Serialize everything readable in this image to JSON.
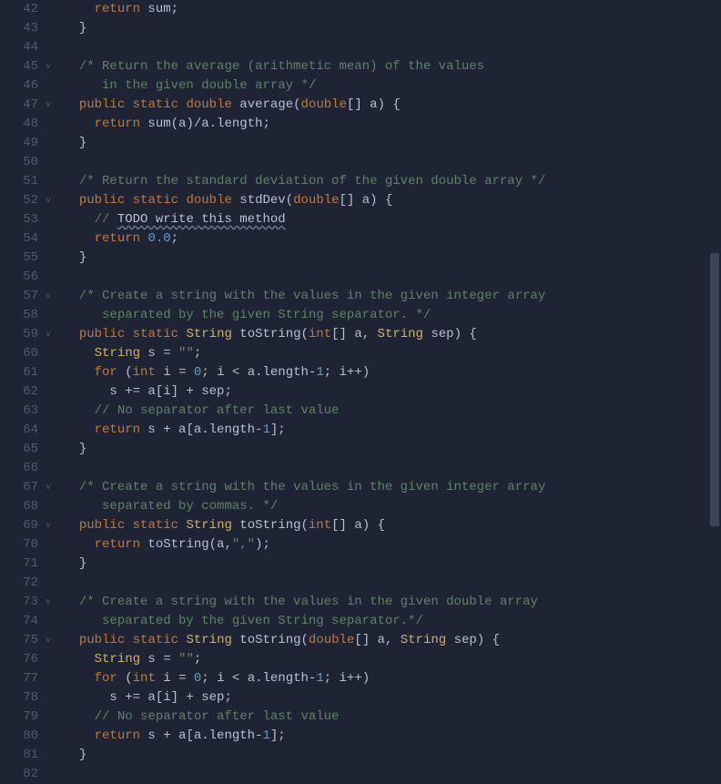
{
  "editor": {
    "startLine": 42,
    "lines": [
      {
        "n": 42,
        "fold": "",
        "tokens": [
          [
            "tk-guide",
            "    "
          ],
          [
            "tk-return",
            "return"
          ],
          [
            "tk-default",
            " sum"
          ],
          [
            "tk-op",
            ";"
          ]
        ]
      },
      {
        "n": 43,
        "fold": "",
        "tokens": [
          [
            "tk-guide",
            "  "
          ],
          [
            "tk-op",
            "}"
          ]
        ]
      },
      {
        "n": 44,
        "fold": "",
        "tokens": []
      },
      {
        "n": 45,
        "fold": "v",
        "tokens": [
          [
            "tk-guide",
            "  "
          ],
          [
            "tk-comment",
            "/* Return the average (arithmetic mean) of the values"
          ]
        ]
      },
      {
        "n": 46,
        "fold": "",
        "tokens": [
          [
            "tk-guide",
            "  "
          ],
          [
            "tk-comment",
            "   in the given double array */"
          ]
        ]
      },
      {
        "n": 47,
        "fold": "v",
        "tokens": [
          [
            "tk-guide",
            "  "
          ],
          [
            "tk-keyword",
            "public"
          ],
          [
            "tk-default",
            " "
          ],
          [
            "tk-keyword",
            "static"
          ],
          [
            "tk-default",
            " "
          ],
          [
            "tk-type",
            "double"
          ],
          [
            "tk-default",
            " average("
          ],
          [
            "tk-type",
            "double"
          ],
          [
            "tk-default",
            "[] a) {"
          ]
        ]
      },
      {
        "n": 48,
        "fold": "",
        "tokens": [
          [
            "tk-guide",
            "    "
          ],
          [
            "tk-return",
            "return"
          ],
          [
            "tk-default",
            " sum(a)/a.length"
          ],
          [
            "tk-op",
            ";"
          ]
        ]
      },
      {
        "n": 49,
        "fold": "",
        "tokens": [
          [
            "tk-guide",
            "  "
          ],
          [
            "tk-op",
            "}"
          ]
        ]
      },
      {
        "n": 50,
        "fold": "",
        "tokens": []
      },
      {
        "n": 51,
        "fold": "",
        "tokens": [
          [
            "tk-guide",
            "  "
          ],
          [
            "tk-comment",
            "/* Return the standard deviation of the given double array */"
          ]
        ]
      },
      {
        "n": 52,
        "fold": "v",
        "tokens": [
          [
            "tk-guide",
            "  "
          ],
          [
            "tk-keyword",
            "public"
          ],
          [
            "tk-default",
            " "
          ],
          [
            "tk-keyword",
            "static"
          ],
          [
            "tk-default",
            " "
          ],
          [
            "tk-type",
            "double"
          ],
          [
            "tk-default",
            " stdDev("
          ],
          [
            "tk-type",
            "double"
          ],
          [
            "tk-default",
            "[] a) {"
          ]
        ]
      },
      {
        "n": 53,
        "fold": "",
        "tokens": [
          [
            "tk-guide",
            "    "
          ],
          [
            "tk-linecomment",
            "// "
          ],
          [
            "tk-todo",
            "TODO write this method"
          ]
        ]
      },
      {
        "n": 54,
        "fold": "",
        "tokens": [
          [
            "tk-guide",
            "    "
          ],
          [
            "tk-return",
            "return"
          ],
          [
            "tk-default",
            " "
          ],
          [
            "tk-number",
            "0.0"
          ],
          [
            "tk-op",
            ";"
          ]
        ]
      },
      {
        "n": 55,
        "fold": "",
        "tokens": [
          [
            "tk-guide",
            "  "
          ],
          [
            "tk-op",
            "}"
          ]
        ]
      },
      {
        "n": 56,
        "fold": "",
        "tokens": []
      },
      {
        "n": 57,
        "fold": "v",
        "tokens": [
          [
            "tk-guide",
            "  "
          ],
          [
            "tk-comment",
            "/* Create a string with the values in the given integer array"
          ]
        ]
      },
      {
        "n": 58,
        "fold": "",
        "tokens": [
          [
            "tk-guide",
            "  "
          ],
          [
            "tk-comment",
            "   separated by the given String separator. */"
          ]
        ]
      },
      {
        "n": 59,
        "fold": "v",
        "tokens": [
          [
            "tk-guide",
            "  "
          ],
          [
            "tk-keyword",
            "public"
          ],
          [
            "tk-default",
            " "
          ],
          [
            "tk-keyword",
            "static"
          ],
          [
            "tk-default",
            " "
          ],
          [
            "tk-classType",
            "String"
          ],
          [
            "tk-default",
            " toString("
          ],
          [
            "tk-type",
            "int"
          ],
          [
            "tk-default",
            "[] a, "
          ],
          [
            "tk-classType",
            "String"
          ],
          [
            "tk-default",
            " sep) {"
          ]
        ]
      },
      {
        "n": 60,
        "fold": "",
        "tokens": [
          [
            "tk-guide",
            "    "
          ],
          [
            "tk-classType",
            "String"
          ],
          [
            "tk-default",
            " s = "
          ],
          [
            "tk-string",
            "\"\""
          ],
          [
            "tk-op",
            ";"
          ]
        ]
      },
      {
        "n": 61,
        "fold": "",
        "tokens": [
          [
            "tk-guide",
            "    "
          ],
          [
            "tk-keyword",
            "for"
          ],
          [
            "tk-default",
            " ("
          ],
          [
            "tk-type",
            "int"
          ],
          [
            "tk-default",
            " i = "
          ],
          [
            "tk-number",
            "0"
          ],
          [
            "tk-default",
            "; i < a.length-"
          ],
          [
            "tk-number",
            "1"
          ],
          [
            "tk-default",
            "; i++)"
          ]
        ]
      },
      {
        "n": 62,
        "fold": "",
        "tokens": [
          [
            "tk-guide",
            "      "
          ],
          [
            "tk-default",
            "s += a[i] + sep;"
          ]
        ]
      },
      {
        "n": 63,
        "fold": "",
        "tokens": [
          [
            "tk-guide",
            "    "
          ],
          [
            "tk-linecomment",
            "// No separator after last value"
          ]
        ]
      },
      {
        "n": 64,
        "fold": "",
        "tokens": [
          [
            "tk-guide",
            "    "
          ],
          [
            "tk-return",
            "return"
          ],
          [
            "tk-default",
            " s + a[a.length-"
          ],
          [
            "tk-number",
            "1"
          ],
          [
            "tk-default",
            "];"
          ]
        ]
      },
      {
        "n": 65,
        "fold": "",
        "tokens": [
          [
            "tk-guide",
            "  "
          ],
          [
            "tk-op",
            "}"
          ]
        ]
      },
      {
        "n": 66,
        "fold": "",
        "tokens": []
      },
      {
        "n": 67,
        "fold": "v",
        "tokens": [
          [
            "tk-guide",
            "  "
          ],
          [
            "tk-comment",
            "/* Create a string with the values in the given integer array"
          ]
        ]
      },
      {
        "n": 68,
        "fold": "",
        "tokens": [
          [
            "tk-guide",
            "  "
          ],
          [
            "tk-comment",
            "   separated by commas. */"
          ]
        ]
      },
      {
        "n": 69,
        "fold": "v",
        "tokens": [
          [
            "tk-guide",
            "  "
          ],
          [
            "tk-keyword",
            "public"
          ],
          [
            "tk-default",
            " "
          ],
          [
            "tk-keyword",
            "static"
          ],
          [
            "tk-default",
            " "
          ],
          [
            "tk-classType",
            "String"
          ],
          [
            "tk-default",
            " toString("
          ],
          [
            "tk-type",
            "int"
          ],
          [
            "tk-default",
            "[] a) {"
          ]
        ]
      },
      {
        "n": 70,
        "fold": "",
        "tokens": [
          [
            "tk-guide",
            "    "
          ],
          [
            "tk-return",
            "return"
          ],
          [
            "tk-default",
            " toString(a,"
          ],
          [
            "tk-string",
            "\",\""
          ],
          [
            "tk-default",
            ");"
          ]
        ]
      },
      {
        "n": 71,
        "fold": "",
        "tokens": [
          [
            "tk-guide",
            "  "
          ],
          [
            "tk-op",
            "}"
          ]
        ]
      },
      {
        "n": 72,
        "fold": "",
        "tokens": []
      },
      {
        "n": 73,
        "fold": "v",
        "tokens": [
          [
            "tk-guide",
            "  "
          ],
          [
            "tk-comment",
            "/* Create a string with the values in the given double array"
          ]
        ]
      },
      {
        "n": 74,
        "fold": "",
        "tokens": [
          [
            "tk-guide",
            "  "
          ],
          [
            "tk-comment",
            "   separated by the given String separator.*/"
          ]
        ]
      },
      {
        "n": 75,
        "fold": "v",
        "tokens": [
          [
            "tk-guide",
            "  "
          ],
          [
            "tk-keyword",
            "public"
          ],
          [
            "tk-default",
            " "
          ],
          [
            "tk-keyword",
            "static"
          ],
          [
            "tk-default",
            " "
          ],
          [
            "tk-classType",
            "String"
          ],
          [
            "tk-default",
            " toString("
          ],
          [
            "tk-type",
            "double"
          ],
          [
            "tk-default",
            "[] a, "
          ],
          [
            "tk-classType",
            "String"
          ],
          [
            "tk-default",
            " sep) {"
          ]
        ]
      },
      {
        "n": 76,
        "fold": "",
        "tokens": [
          [
            "tk-guide",
            "    "
          ],
          [
            "tk-classType",
            "String"
          ],
          [
            "tk-default",
            " s = "
          ],
          [
            "tk-string",
            "\"\""
          ],
          [
            "tk-op",
            ";"
          ]
        ]
      },
      {
        "n": 77,
        "fold": "",
        "tokens": [
          [
            "tk-guide",
            "    "
          ],
          [
            "tk-keyword",
            "for"
          ],
          [
            "tk-default",
            " ("
          ],
          [
            "tk-type",
            "int"
          ],
          [
            "tk-default",
            " i = "
          ],
          [
            "tk-number",
            "0"
          ],
          [
            "tk-default",
            "; i < a.length-"
          ],
          [
            "tk-number",
            "1"
          ],
          [
            "tk-default",
            "; i++)"
          ]
        ]
      },
      {
        "n": 78,
        "fold": "",
        "tokens": [
          [
            "tk-guide",
            "      "
          ],
          [
            "tk-default",
            "s += a[i] + sep;"
          ]
        ]
      },
      {
        "n": 79,
        "fold": "",
        "tokens": [
          [
            "tk-guide",
            "    "
          ],
          [
            "tk-linecomment",
            "// No separator after last value"
          ]
        ]
      },
      {
        "n": 80,
        "fold": "",
        "tokens": [
          [
            "tk-guide",
            "    "
          ],
          [
            "tk-return",
            "return"
          ],
          [
            "tk-default",
            " s + a[a.length-"
          ],
          [
            "tk-number",
            "1"
          ],
          [
            "tk-default",
            "];"
          ]
        ]
      },
      {
        "n": 81,
        "fold": "",
        "tokens": [
          [
            "tk-guide",
            "  "
          ],
          [
            "tk-op",
            "}"
          ]
        ]
      },
      {
        "n": 82,
        "fold": "",
        "tokens": []
      }
    ]
  },
  "scrollbar": {
    "thumbTop": 278,
    "thumbHeight": 300
  }
}
